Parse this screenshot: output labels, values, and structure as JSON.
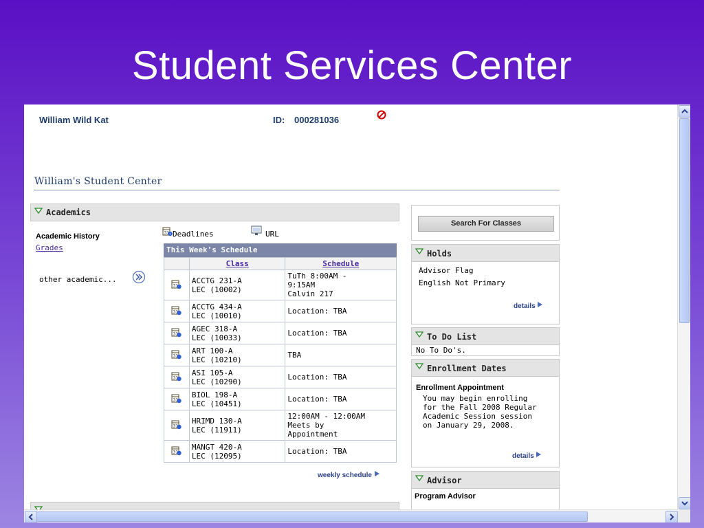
{
  "slide": {
    "title": "Student Services Center"
  },
  "header": {
    "name": "William Wild Kat",
    "id_label": "ID:",
    "id_value": "000281036"
  },
  "student_center": {
    "title": "William's Student Center"
  },
  "academics": {
    "section_label": "Academics",
    "academic_history_label": "Academic History",
    "grades_link": "Grades",
    "other_academic_select": "other academic...",
    "deadlines_link": "Deadlines",
    "url_link": "URL",
    "schedule": {
      "title": "This Week's Schedule",
      "col_class": "Class",
      "col_schedule": "Schedule",
      "rows": [
        {
          "class1": "ACCTG 231-A",
          "class2": "LEC (10002)",
          "sched1": "TuTh 8:00AM -",
          "sched2": "9:15AM",
          "sched3": "Calvin 217"
        },
        {
          "class1": "ACCTG 434-A",
          "class2": "LEC (10010)",
          "sched1": "Location:  TBA",
          "sched2": "",
          "sched3": ""
        },
        {
          "class1": "AGEC 318-A",
          "class2": "LEC (10033)",
          "sched1": "Location:  TBA",
          "sched2": "",
          "sched3": ""
        },
        {
          "class1": "ART 100-A",
          "class2": "LEC (10210)",
          "sched1": "TBA",
          "sched2": "",
          "sched3": ""
        },
        {
          "class1": "ASI 105-A",
          "class2": "LEC (10290)",
          "sched1": "Location:  TBA",
          "sched2": "",
          "sched3": ""
        },
        {
          "class1": "BIOL 198-A",
          "class2": "LEC (10451)",
          "sched1": "Location:  TBA",
          "sched2": "",
          "sched3": ""
        },
        {
          "class1": "HRIMD 130-A",
          "class2": "LEC (11911)",
          "sched1": "12:00AM - 12:00AM",
          "sched2": "Meets by",
          "sched3": "Appointment"
        },
        {
          "class1": "MANGT 420-A",
          "class2": "LEC (12095)",
          "sched1": "Location:  TBA",
          "sched2": "",
          "sched3": ""
        }
      ],
      "weekly_link": "weekly schedule"
    }
  },
  "sidebar": {
    "search_button": "Search For Classes",
    "holds": {
      "label": "Holds",
      "items": [
        "Advisor Flag",
        "English Not Primary"
      ],
      "details": "details"
    },
    "todo": {
      "label": "To Do List",
      "text": "No To Do's."
    },
    "enrollment": {
      "label": "Enrollment Dates",
      "heading": "Enrollment Appointment",
      "lines": [
        "You may begin enrolling",
        "for the Fall 2008 Regular",
        "Academic Session session",
        "on January 29, 2008."
      ],
      "details": "details"
    },
    "advisor": {
      "label": "Advisor",
      "heading": "Program Advisor"
    }
  },
  "colors": {
    "accent": "#4a2aa0",
    "header_text": "#1d3b6b",
    "schedule_header": "#7b86a8",
    "slide_bg": "#5a0fc4"
  }
}
